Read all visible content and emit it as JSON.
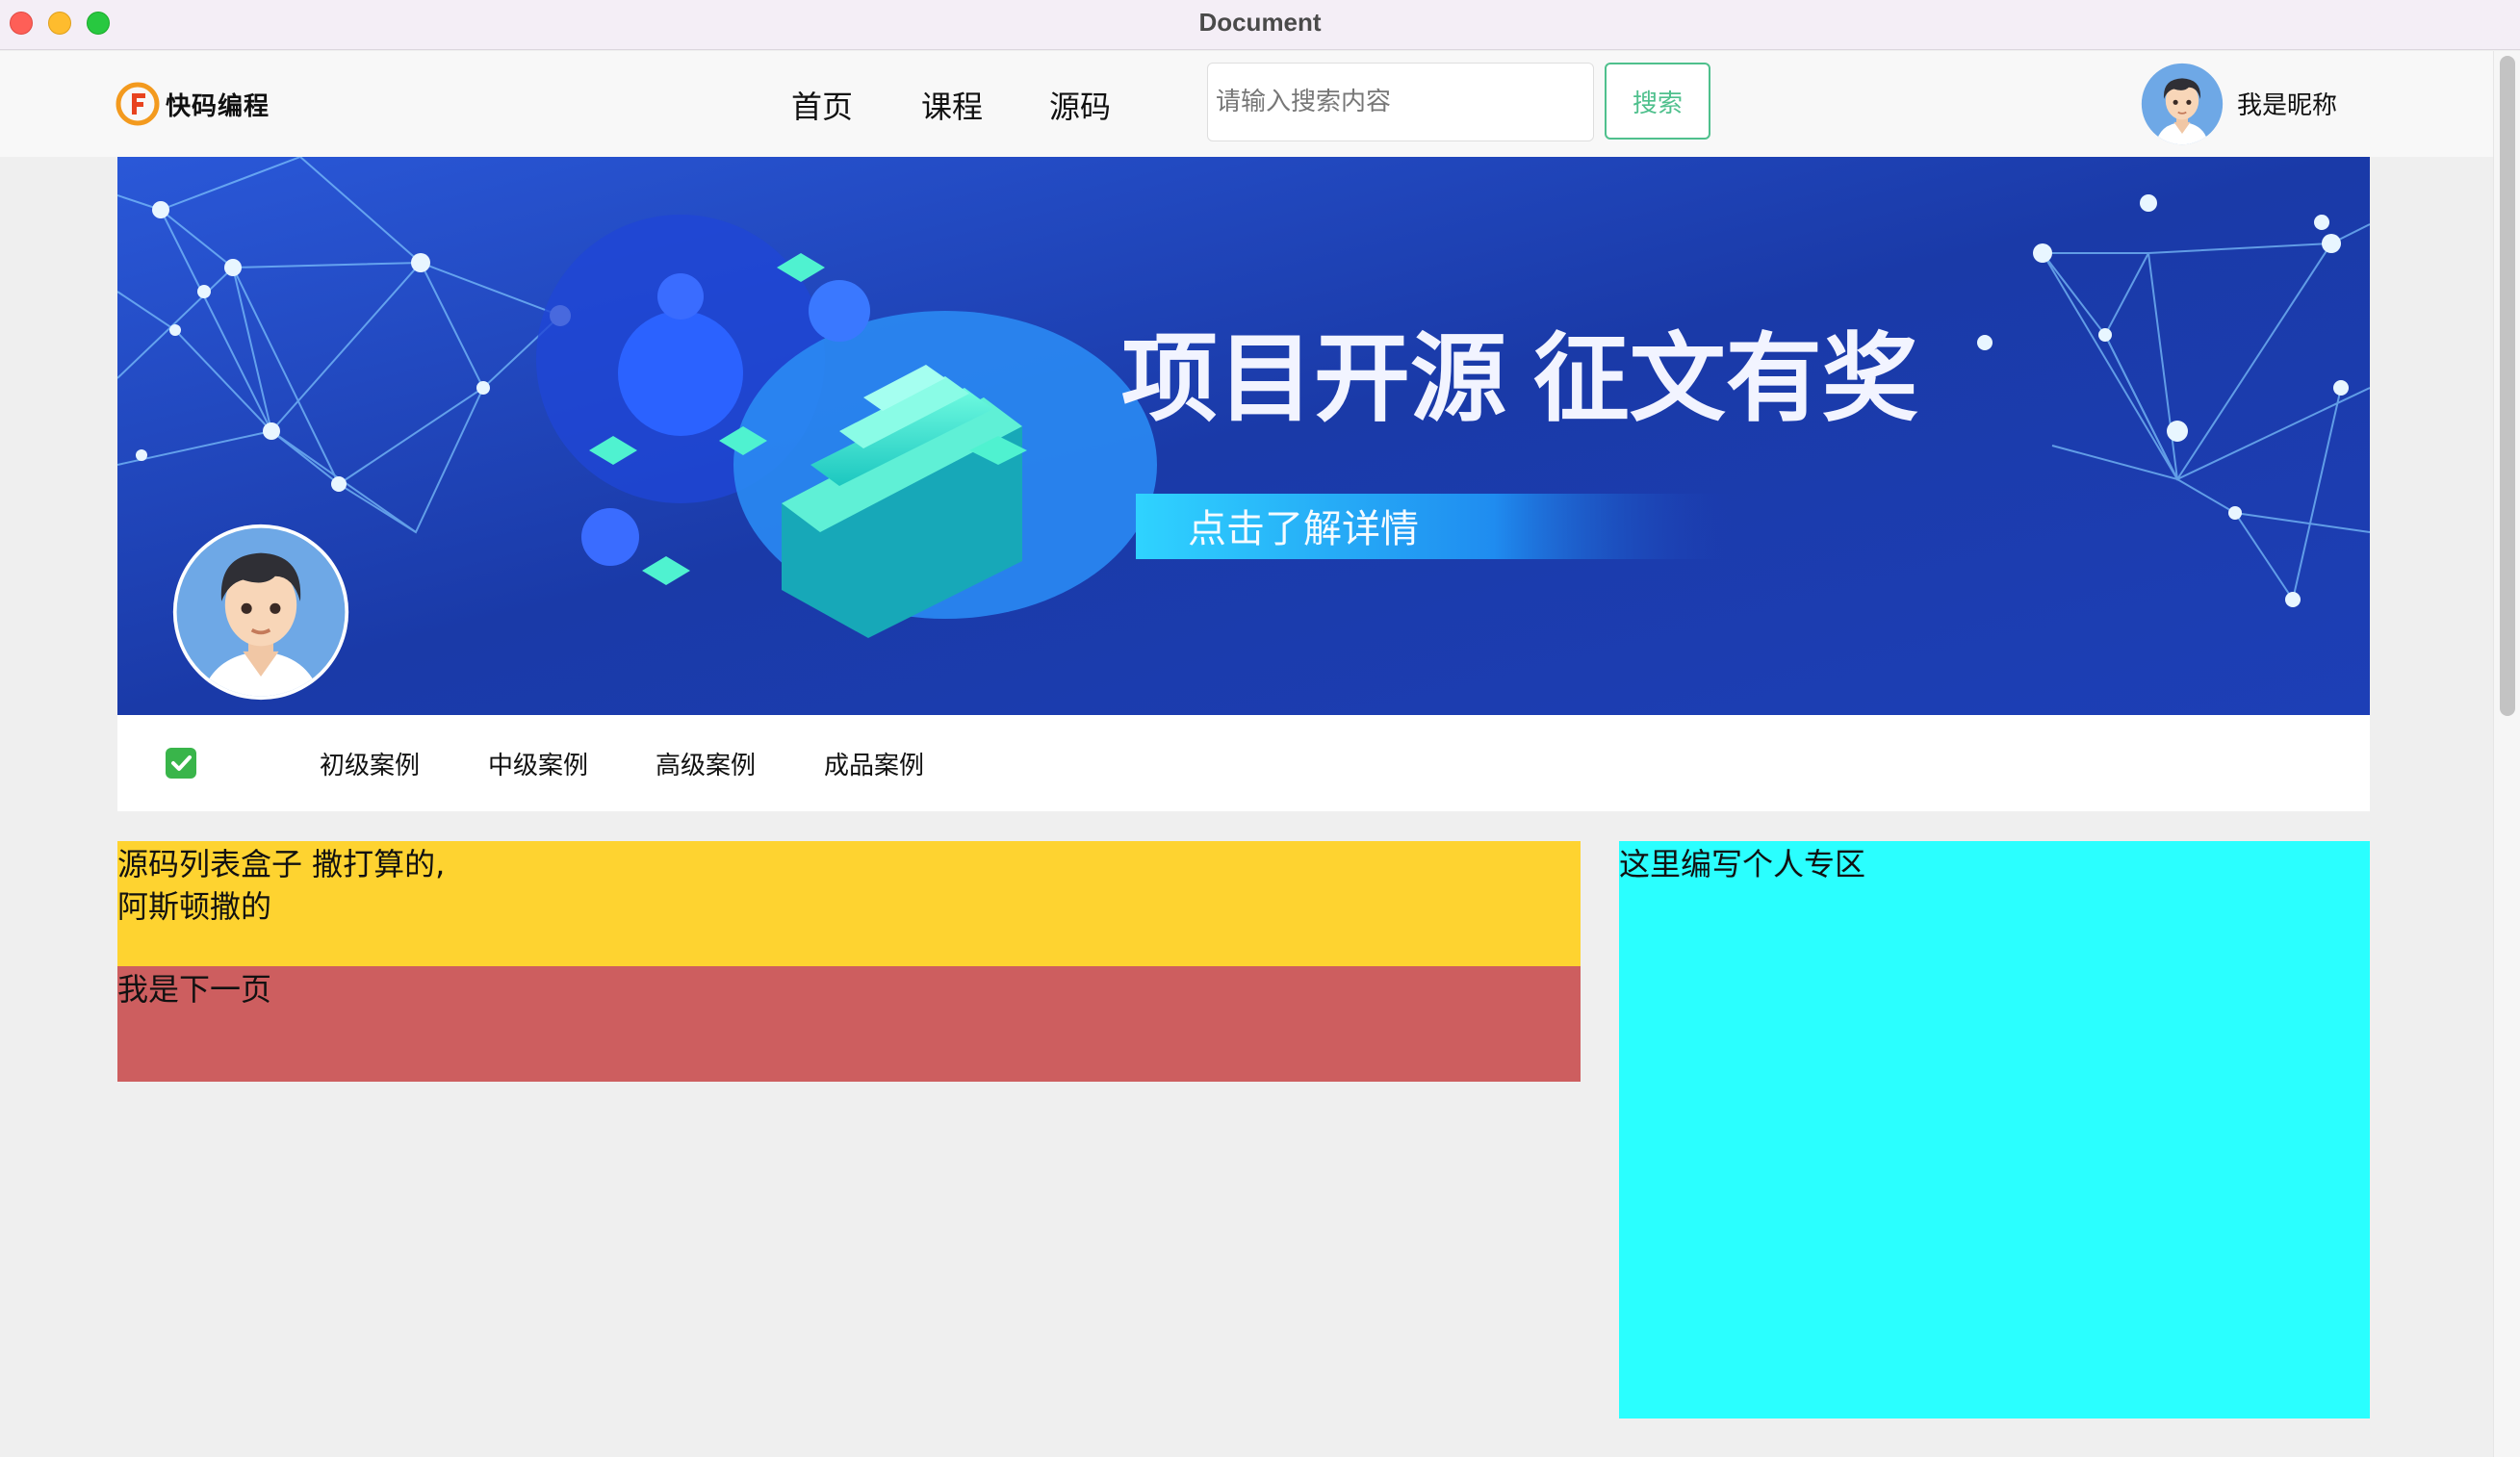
{
  "window": {
    "title": "Document"
  },
  "header": {
    "logo_text": "快码编程",
    "nav": [
      "首页",
      "课程",
      "源码"
    ],
    "search": {
      "placeholder": "请输入搜索内容",
      "button_label": "搜索"
    },
    "user": {
      "nickname": "我是昵称"
    }
  },
  "banner": {
    "headline": "项目开源  征文有奖",
    "cta": "点击了解详情"
  },
  "tabs": [
    "初级案例",
    "中级案例",
    "高级案例",
    "成品案例"
  ],
  "content": {
    "source_list": "源码列表盒子 撒打算的,\n阿斯顿撒的",
    "next_page": "我是下一页",
    "personal_zone": "这里编写个人专区"
  },
  "colors": {
    "accent": "#4fc08d",
    "source_list_bg": "#fed330",
    "next_page_bg": "#cd5e5f",
    "personal_zone_bg": "#2affff",
    "banner_bg": "#1b3db5"
  },
  "icons": [
    "logo-f-icon",
    "user-avatar-icon",
    "check-icon"
  ]
}
